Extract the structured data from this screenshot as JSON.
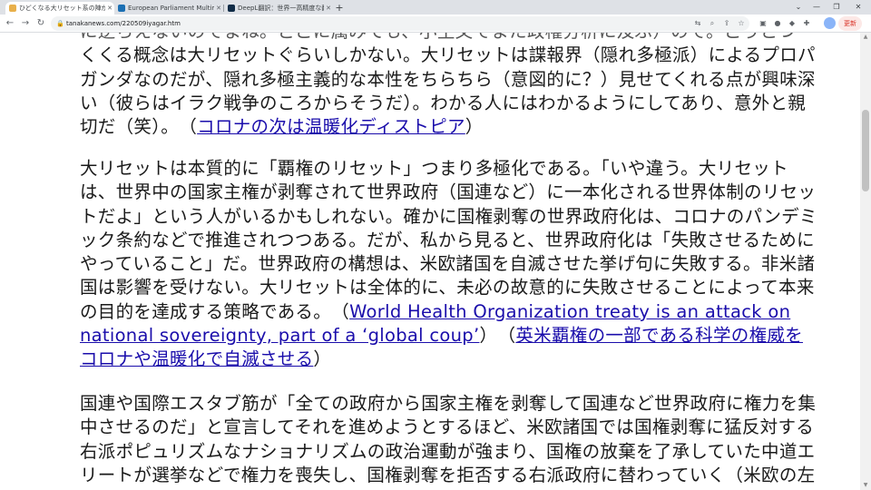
{
  "tabs": [
    {
      "title": "ひどくなる大リセット系の陣がらせ",
      "favicon_color": "#e8b04b",
      "active": true
    },
    {
      "title": "European Parliament Multimedia",
      "favicon_color": "#1b6fb3",
      "active": false
    },
    {
      "title": "DeepL翻訳：世界一高精度な翻訳",
      "favicon_color": "#0f2b46",
      "active": false
    }
  ],
  "browser": {
    "url": "tanakanews.com/220509iyagar.htm",
    "update_label": "更新"
  },
  "paragraphs": [
    {
      "lines": [
        "に逆らえないのでまね。どこに属みても、小主文でまた政権分析に及ぶ）ので。こうとつ",
        "くくる概念は大リセットぐらいしかない。大リセットは諜報界（隠れ多極派）によるプロパ",
        "ガンダなのだが、隠れ多極主義的な本性をちらちら（意図的に？）見せてくれる点が興味深",
        "い（彼らはイラク戦争のころからそうだ）。わかる人にはわかるようにしてあり、意外と親"
      ],
      "last_text": "切だ（笑）。　（",
      "link": "コロナの次は温暖化ディストピア",
      "after": "）"
    },
    {
      "lines": [
        "大リセットは本質的に「覇権のリセット」つまり多極化である。「いや違う。大リセット",
        "は、世界中の国家主権が剥奪されて世界政府（国連など）に一本化される世界体制のリセッ",
        "トだよ」という人がいるかもしれない。確かに国権剥奪の世界政府化は、コロナのパンデミ",
        "ック条約などで推進されつつある。だが、私から見ると、世界政府化は「失敗させるために",
        "やっていること」だ。世界政府の構想は、米欧諸国を自滅させた挙げ句に失敗する。非米諸",
        "国は影響を受けない。大リセットは全体的に、未必の故意的に失敗させることによって本来"
      ],
      "line7_text": "の目的を達成する策略である。　（",
      "link1_part1": "World Health Organization treaty is an attack on",
      "link1_part2": "national sovereignty, part of a ‘global coup’",
      "between": "）　（",
      "link2_part1": "英米覇権の一部である科学の権威を",
      "link2_part2": "コロナや温暖化で自滅させる",
      "after": "）"
    },
    {
      "lines": [
        "国連や国際エスタブ筋が「全ての政府から国家主権を剥奪して国連など世界政府に権力を集",
        "中させるのだ」と宣言してそれを進めようとするほど、米欧諸国では国権剥奪に猛反対する",
        "右派ポピュリズムなナショナリズムの政治運動が強まり、国権の放棄を了承していた中道エ",
        "リートが選挙などで権力を喪失し、国権剥奪を拒否する右派政府に替わっていく（米欧の左"
      ]
    }
  ]
}
